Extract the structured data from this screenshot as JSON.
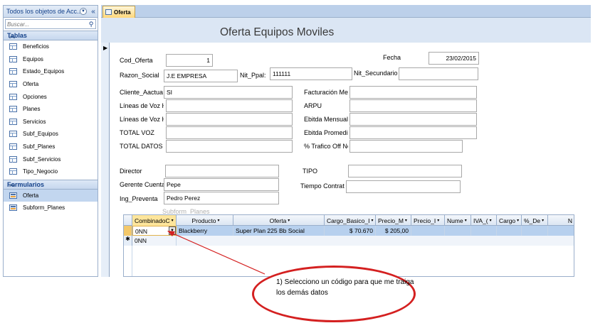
{
  "nav": {
    "title": "Todos los objetos de Acc...",
    "search_placeholder": "Buscar...",
    "groups": [
      {
        "name": "Tablas",
        "items": [
          "Beneficios",
          "Equipos",
          "Estado_Equipos",
          "Oferta",
          "Opciones",
          "Planes",
          "Servicios",
          "Subf_Equipos",
          "Subf_Planes",
          "Subf_Servicios",
          "Tipo_Negocio"
        ]
      },
      {
        "name": "Formularios",
        "items": [
          "Oferta",
          "Subform_Planes"
        ]
      }
    ],
    "selected_form": "Oferta"
  },
  "document": {
    "tab_label": "Oferta",
    "form_title": "Oferta Equipos Moviles"
  },
  "form": {
    "cod_oferta": {
      "label": "Cod_Oferta",
      "value": "1"
    },
    "fecha": {
      "label": "Fecha",
      "value": "23/02/2015"
    },
    "razon_social": {
      "label": "Razon_Social",
      "value": "J.E EMPRESA"
    },
    "nit_ppal": {
      "label": "Nit_Ppal:",
      "value": "111111"
    },
    "nit_secundario": {
      "label": "Nit_Secundario",
      "value": ""
    },
    "cliente_actual": {
      "label": "Cliente_Aactua",
      "value": "SI"
    },
    "facturacion": {
      "label": "Facturación Me",
      "value": ""
    },
    "lineas_voz_h1": {
      "label": "Líneas de Voz H",
      "value": ""
    },
    "arpu": {
      "label": "ARPU",
      "value": ""
    },
    "lineas_voz_h2": {
      "label": "Líneas de Voz H",
      "value": ""
    },
    "ebitda_mensual": {
      "label": "Ebitda Mensual",
      "value": ""
    },
    "total_voz": {
      "label": "TOTAL VOZ",
      "value": ""
    },
    "ebitda_promedio": {
      "label": "Ebitda Promedi",
      "value": ""
    },
    "total_datos": {
      "label": "TOTAL DATOS",
      "value": ""
    },
    "trafico_off_net": {
      "label": "% Trafico Off Ne",
      "value": ""
    },
    "director": {
      "label": "Director",
      "value": ""
    },
    "tipo": {
      "label": "TIPO",
      "value": ""
    },
    "gerente_cuenta": {
      "label": "Gerente Cuenta",
      "value": "Pepe"
    },
    "tiempo_contrato": {
      "label": "Tiempo Contrat",
      "value": ""
    },
    "ing_preventa": {
      "label": "Ing_Preventa",
      "value": "Pedro Perez"
    }
  },
  "subform": {
    "caption": "Subform_Planes",
    "columns": [
      "CombinadoC",
      "Producto",
      "Oferta",
      "Cargo_Basico_I",
      "Precio_M",
      "Precio_I",
      "Nume",
      "IVA_(",
      "Cargo",
      "%_De",
      "N"
    ],
    "rows": [
      {
        "combinado": "0NN",
        "producto": "Blackberry",
        "oferta": "Super Plan 225 Bb Social",
        "cargo_basico": "$ 70.670",
        "precio_m": "$ 205,00"
      }
    ],
    "new_row": {
      "combinado": "0NN"
    }
  },
  "annotation": {
    "text": "1) Selecciono un código para que me traiga los demás datos",
    "color": "#d42020"
  }
}
